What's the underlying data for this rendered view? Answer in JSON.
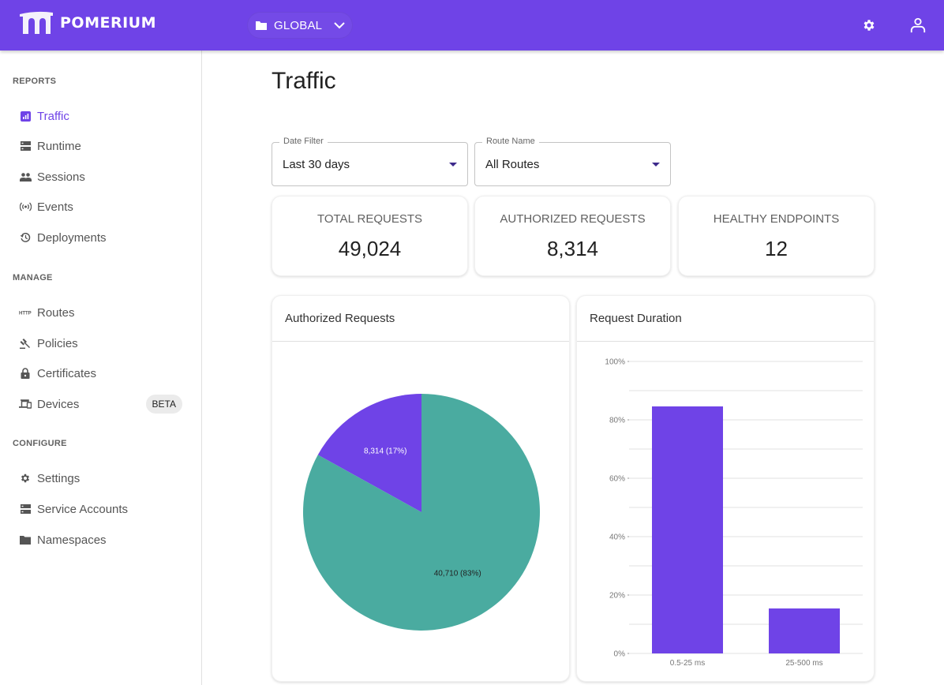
{
  "header": {
    "brand": "POMERIUM",
    "namespace": "GLOBAL",
    "icons": [
      "folder-icon",
      "chevron-down-icon",
      "gear-icon",
      "user-icon"
    ],
    "accent": "#6f43e7"
  },
  "sidebar": {
    "sections": [
      {
        "title": "REPORTS",
        "items": [
          {
            "label": "Traffic",
            "icon": "bar-chart-icon",
            "active": true
          },
          {
            "label": "Runtime",
            "icon": "storage-icon"
          },
          {
            "label": "Sessions",
            "icon": "people-icon"
          },
          {
            "label": "Events",
            "icon": "broadcast-icon"
          },
          {
            "label": "Deployments",
            "icon": "history-icon"
          }
        ]
      },
      {
        "title": "MANAGE",
        "items": [
          {
            "label": "Routes",
            "icon": "http-icon"
          },
          {
            "label": "Policies",
            "icon": "gavel-icon"
          },
          {
            "label": "Certificates",
            "icon": "lock-icon"
          },
          {
            "label": "Devices",
            "icon": "devices-icon",
            "badge": "BETA"
          }
        ]
      },
      {
        "title": "CONFIGURE",
        "items": [
          {
            "label": "Settings",
            "icon": "gear-icon"
          },
          {
            "label": "Service Accounts",
            "icon": "storage-icon"
          },
          {
            "label": "Namespaces",
            "icon": "folder-icon"
          }
        ]
      }
    ]
  },
  "main": {
    "title": "Traffic",
    "filters": [
      {
        "label": "Date Filter",
        "value": "Last 30 days"
      },
      {
        "label": "Route Name",
        "value": "All Routes"
      }
    ],
    "stats": [
      {
        "label": "TOTAL REQUESTS",
        "value": "49,024"
      },
      {
        "label": "AUTHORIZED REQUESTS",
        "value": "8,314"
      },
      {
        "label": "HEALTHY ENDPOINTS",
        "value": "12"
      }
    ],
    "cards": [
      {
        "title": "Authorized Requests"
      },
      {
        "title": "Request Duration"
      }
    ]
  },
  "chart_data": [
    {
      "type": "pie",
      "title": "Authorized Requests",
      "slices": [
        {
          "label": "8,314 (17%)",
          "value": 8314,
          "color": "#6f43e7"
        },
        {
          "label": "40,710 (83%)",
          "value": 40710,
          "color": "#4aaba0"
        }
      ]
    },
    {
      "type": "bar",
      "title": "Request Duration",
      "categories": [
        "0.5-25 ms",
        "25-500 ms"
      ],
      "values": [
        84.6,
        15.4
      ],
      "yticks": [
        "0%",
        "20%",
        "40%",
        "60%",
        "80%",
        "100%"
      ],
      "ylim": [
        0,
        100
      ],
      "grid": true,
      "color": "#6f43e7",
      "xlabel": "",
      "ylabel": ""
    }
  ]
}
